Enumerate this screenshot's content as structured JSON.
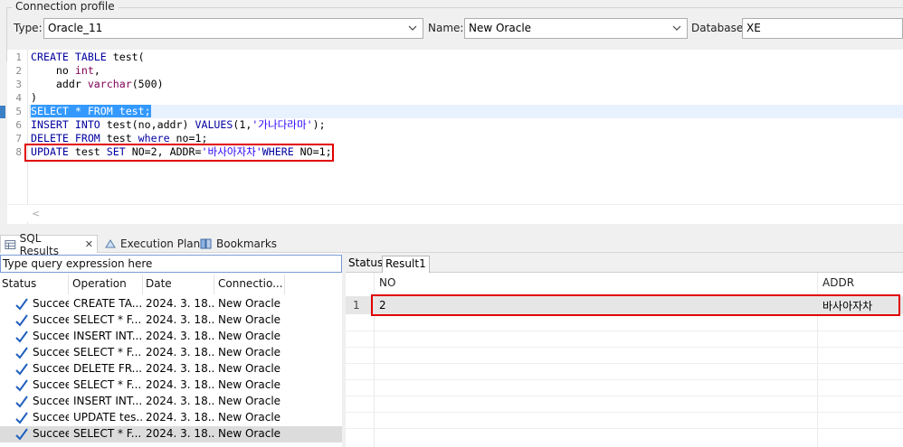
{
  "connection": {
    "legend": "Connection profile",
    "type_label": "Type:",
    "type_value": "Oracle_11",
    "name_label": "Name:",
    "name_value": "New Oracle",
    "database_label": "Database:",
    "database_value": "XE"
  },
  "editor": {
    "lines": [
      {
        "n": "1",
        "text": ""
      },
      {
        "n": "2",
        "text": ""
      },
      {
        "n": "3",
        "text": ""
      },
      {
        "n": "4",
        "text": ""
      },
      {
        "n": "5",
        "text": ""
      },
      {
        "n": "6",
        "text": ""
      },
      {
        "n": "7",
        "text": ""
      },
      {
        "n": "8",
        "text": ""
      }
    ],
    "l1_kw": "CREATE TABLE",
    "l1_rest": " test(",
    "l2_a": "    no ",
    "l2_ty": "int",
    "l2_b": ",",
    "l3_a": "    addr ",
    "l3_ty": "varchar",
    "l3_b": "(500)",
    "l4": ")",
    "l5": "SELECT * FROM test;",
    "l6_kw1": "INSERT INTO",
    "l6_a": " test(no,addr) ",
    "l6_kw2": "VALUES",
    "l6_b": "(1,",
    "l6_str": "'가나다라마'",
    "l6_c": ");",
    "l7_kw1": "DELETE FROM",
    "l7_a": " test ",
    "l7_kw2": "where",
    "l7_b": " no=1;",
    "l8_kw1": "UPDATE",
    "l8_a": " test ",
    "l8_kw2": "SET",
    "l8_b": " NO=2, ADDR=",
    "l8_str": "'바사아자차'",
    "l8_kw3": "WHERE",
    "l8_c": " NO=1;",
    "hscroll_arrow": "<"
  },
  "bottom_tabs": {
    "sql_results": "SQL Results",
    "close": "✕",
    "execution_plan": "Execution Plan",
    "bookmarks": "Bookmarks"
  },
  "query_expression_placeholder": "Type query expression here",
  "results_log": {
    "columns": [
      "Status",
      "Operation",
      "Date",
      "Connectio..."
    ],
    "rows": [
      {
        "status": "Succeee",
        "operation": "CREATE TA...",
        "date": "2024. 3. 18...",
        "connection": "New Oracle"
      },
      {
        "status": "Succeee",
        "operation": "SELECT * F...",
        "date": "2024. 3. 18...",
        "connection": "New Oracle"
      },
      {
        "status": "Succeee",
        "operation": "INSERT INT...",
        "date": "2024. 3. 18...",
        "connection": "New Oracle"
      },
      {
        "status": "Succeee",
        "operation": "SELECT * F...",
        "date": "2024. 3. 18...",
        "connection": "New Oracle"
      },
      {
        "status": "Succeee",
        "operation": "DELETE FR...",
        "date": "2024. 3. 18...",
        "connection": "New Oracle"
      },
      {
        "status": "Succeee",
        "operation": "SELECT * F...",
        "date": "2024. 3. 18...",
        "connection": "New Oracle"
      },
      {
        "status": "Succeee",
        "operation": "INSERT INT...",
        "date": "2024. 3. 18...",
        "connection": "New Oracle"
      },
      {
        "status": "Succeee",
        "operation": "UPDATE tes...",
        "date": "2024. 3. 18...",
        "connection": "New Oracle"
      },
      {
        "status": "Succeee",
        "operation": "SELECT * F...",
        "date": "2024. 3. 18...",
        "connection": "New Oracle"
      }
    ]
  },
  "result_panel": {
    "tabs": [
      "Status",
      "Result1"
    ],
    "columns": [
      "NO",
      "ADDR"
    ],
    "rows": [
      {
        "index": "1",
        "no": "2",
        "addr": "바사아자차"
      }
    ]
  },
  "colors": {
    "highlight_red": "#e00000",
    "selection_blue": "#3399ff",
    "keyword": "#0000a0",
    "check_blue": "#1f5fbf"
  }
}
